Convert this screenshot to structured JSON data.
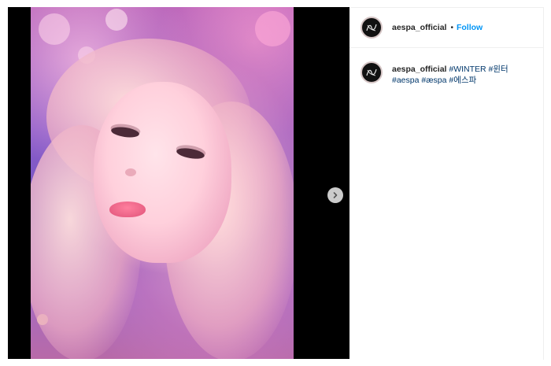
{
  "post": {
    "username": "aespa_official",
    "separator": "•",
    "follow_label": "Follow"
  },
  "caption": {
    "username": "aespa_official",
    "hashtags": [
      "#WINTER",
      "#윈터",
      "#aespa",
      "#æspa",
      "#에스파"
    ]
  },
  "icons": {
    "next": "chevron-right-icon",
    "avatar_logo": "aespa-logo"
  },
  "colors": {
    "follow": "#0095f6",
    "hashtag": "#00376b",
    "text": "#262626",
    "media_background": "#000000"
  }
}
